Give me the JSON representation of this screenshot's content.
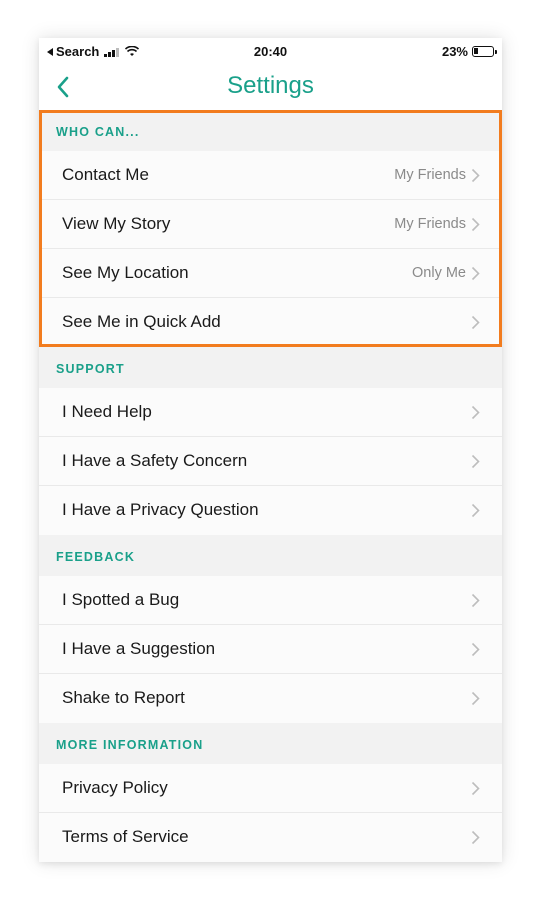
{
  "status_bar": {
    "carrier": "Search",
    "time": "20:40",
    "battery": "23%"
  },
  "nav": {
    "title": "Settings",
    "back_icon": "chevron-left-icon"
  },
  "colors": {
    "accent": "#1aa08a",
    "highlight": "#f27c1e"
  },
  "sections": [
    {
      "header": "WHO CAN...",
      "rows": [
        {
          "label": "Contact Me",
          "value": "My Friends"
        },
        {
          "label": "View My Story",
          "value": "My Friends"
        },
        {
          "label": "See My Location",
          "value": "Only Me"
        },
        {
          "label": "See Me in Quick Add",
          "value": ""
        }
      ]
    },
    {
      "header": "SUPPORT",
      "rows": [
        {
          "label": "I Need Help",
          "value": ""
        },
        {
          "label": "I Have a Safety Concern",
          "value": ""
        },
        {
          "label": "I Have a Privacy Question",
          "value": ""
        }
      ]
    },
    {
      "header": "FEEDBACK",
      "rows": [
        {
          "label": "I Spotted a Bug",
          "value": ""
        },
        {
          "label": "I Have a Suggestion",
          "value": ""
        },
        {
          "label": "Shake to Report",
          "value": ""
        }
      ]
    },
    {
      "header": "MORE INFORMATION",
      "rows": [
        {
          "label": "Privacy Policy",
          "value": ""
        },
        {
          "label": "Terms of Service",
          "value": ""
        }
      ]
    }
  ]
}
